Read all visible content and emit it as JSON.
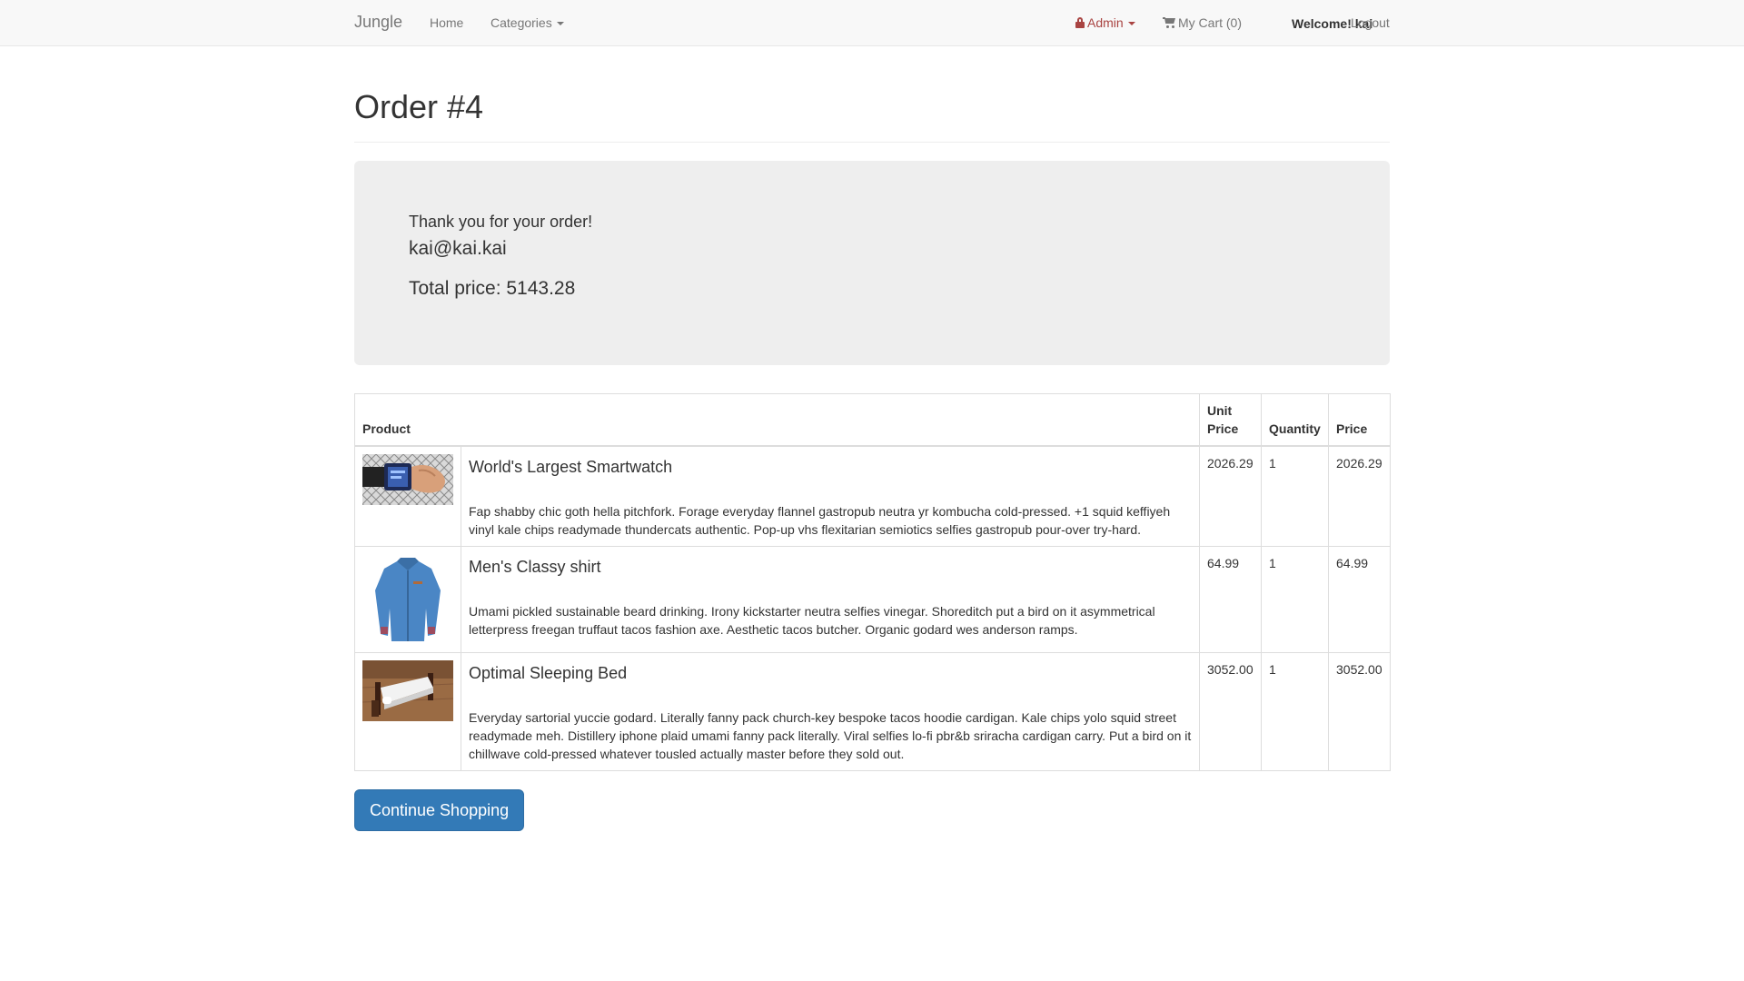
{
  "navbar": {
    "brand": "Jungle",
    "home": "Home",
    "categories": "Categories",
    "admin": "Admin",
    "cart": "My Cart (0)",
    "welcome": "Welcome! kai",
    "logout": "Logout"
  },
  "order": {
    "title": "Order #4",
    "thanks": "Thank you for your order!",
    "email": "kai@kai.kai",
    "total": "Total price: 5143.28"
  },
  "table": {
    "headers": {
      "product": "Product",
      "unit_price": "Unit Price",
      "quantity": "Quantity",
      "price": "Price"
    },
    "rows": [
      {
        "name": "World's Largest Smartwatch",
        "description": "Fap shabby chic goth hella pitchfork. Forage everyday flannel gastropub neutra yr kombucha cold-pressed. +1 squid keffiyeh vinyl kale chips readymade thundercats authentic. Pop-up vhs flexitarian semiotics selfies gastropub pour-over try-hard.",
        "unit_price": "2026.29",
        "quantity": "1",
        "price": "2026.29",
        "image": "smartwatch-image"
      },
      {
        "name": "Men's Classy shirt",
        "description": "Umami pickled sustainable beard drinking. Irony kickstarter neutra selfies vinegar. Shoreditch put a bird on it asymmetrical letterpress freegan truffaut tacos fashion axe. Aesthetic tacos butcher. Organic godard wes anderson ramps.",
        "unit_price": "64.99",
        "quantity": "1",
        "price": "64.99",
        "image": "shirt-image"
      },
      {
        "name": "Optimal Sleeping Bed",
        "description": "Everyday sartorial yuccie godard. Literally fanny pack church-key bespoke tacos hoodie cardigan. Kale chips yolo squid street readymade meh. Distillery iphone plaid umami fanny pack literally. Viral selfies lo-fi pbr&b sriracha cardigan carry. Put a bird on it chillwave cold-pressed whatever tousled actually master before they sold out.",
        "unit_price": "3052.00",
        "quantity": "1",
        "price": "3052.00",
        "image": "bed-image"
      }
    ]
  },
  "actions": {
    "continue": "Continue Shopping"
  },
  "colors": {
    "primary": "#337ab7",
    "admin": "#a94442",
    "navbar_bg": "#f8f8f8",
    "jumbotron_bg": "#eeeeee"
  },
  "icons": {
    "admin": "lock-icon",
    "cart": "cart-icon",
    "dropdown": "caret-down-icon"
  }
}
